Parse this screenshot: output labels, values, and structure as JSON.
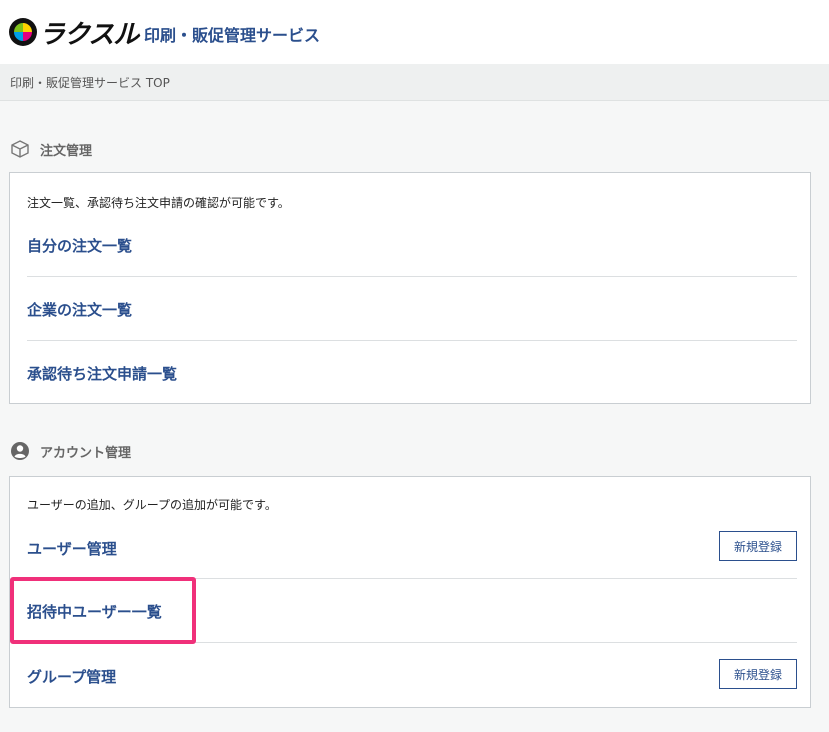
{
  "header": {
    "logo_text": "ラクスル",
    "service_title": "印刷・販促管理サービス"
  },
  "breadcrumb": "印刷・販促管理サービス TOP",
  "order_section": {
    "title": "注文管理",
    "icon": "box-icon",
    "description": "注文一覧、承認待ち注文申請の確認が可能です。",
    "links": [
      "自分の注文一覧",
      "企業の注文一覧",
      "承認待ち注文申請一覧"
    ]
  },
  "account_section": {
    "title": "アカウント管理",
    "icon": "user-circle-icon",
    "description": "ユーザーの追加、グループの追加が可能です。",
    "links": [
      "ユーザー管理",
      "招待中ユーザー一覧",
      "グループ管理"
    ],
    "register_button": "新規登録"
  },
  "colors": {
    "link": "#2b4f8d",
    "highlight": "#f0307a"
  }
}
